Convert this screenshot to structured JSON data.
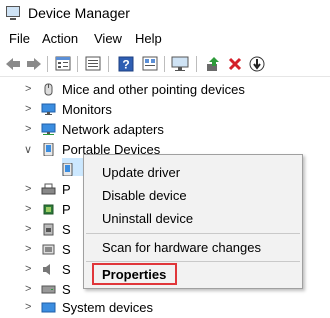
{
  "window": {
    "title": "Device Manager"
  },
  "menu": [
    "File",
    "Action",
    "View",
    "Help"
  ],
  "toolbar": {
    "icons": [
      "back-arrow-icon",
      "forward-arrow-icon",
      "properties-icon",
      "list-icon",
      "help-icon",
      "resources-icon",
      "scan-monitor-icon",
      "update-driver-icon",
      "uninstall-icon",
      "disable-icon"
    ]
  },
  "tree": {
    "items": [
      {
        "label": "Mice and other pointing devices",
        "icon": "mouse-icon",
        "expanded": false
      },
      {
        "label": "Monitors",
        "icon": "monitor-icon",
        "expanded": false
      },
      {
        "label": "Network adapters",
        "icon": "network-icon",
        "expanded": false
      },
      {
        "label": "Portable Devices",
        "icon": "portable-device-icon",
        "expanded": true
      },
      {
        "label": "",
        "icon": "device-icon",
        "expanded": false
      },
      {
        "label": "P",
        "icon": "printer-icon",
        "expanded": false
      },
      {
        "label": "P",
        "icon": "processor-icon",
        "expanded": false
      },
      {
        "label": "S",
        "icon": "security-icon",
        "expanded": false
      },
      {
        "label": "S",
        "icon": "software-icon",
        "expanded": false
      },
      {
        "label": "S",
        "icon": "sound-icon",
        "expanded": false
      },
      {
        "label": "S",
        "icon": "storage-icon",
        "expanded": false
      },
      {
        "label": "System devices",
        "icon": "system-icon",
        "expanded": false
      }
    ]
  },
  "context_menu": {
    "update_driver": "Update driver",
    "disable_device": "Disable device",
    "uninstall_device": "Uninstall device",
    "scan_hardware": "Scan for hardware changes",
    "properties": "Properties"
  }
}
